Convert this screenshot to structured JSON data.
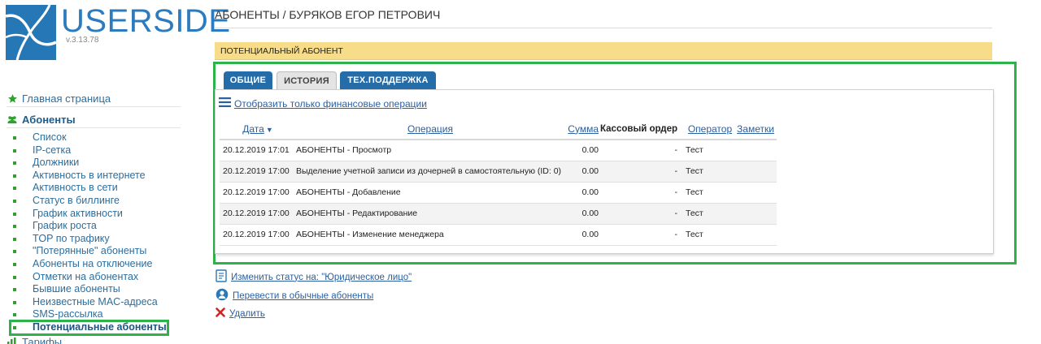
{
  "app": {
    "logo": "USERSIDE",
    "version": "v.3.13.78"
  },
  "sidebar": {
    "main_link": "Главная страница",
    "section": "Абоненты",
    "items": [
      "Список",
      "IP-сетка",
      "Должники",
      "Активность в интернете",
      "Активность в сети",
      "Статус в биллинге",
      "График активности",
      "График роста",
      "TOP по трафику",
      "\"Потерянные\" абоненты",
      "Абоненты на отключение",
      "Отметки на абонентах",
      "Бывшие абоненты",
      "Неизвестные MAC-адреса",
      "SMS-рассылка",
      "Потенциальные абоненты"
    ],
    "next_section": "Тарифы"
  },
  "header": {
    "breadcrumb": "АБОНЕНТЫ / БУРЯКОВ ЕГОР ПЕТРОВИЧ",
    "status": "ПОТЕНЦИАЛЬНЫЙ АБОНЕНТ"
  },
  "tabs": [
    "ОБЩИЕ",
    "ИСТОРИЯ",
    "ТЕХ.ПОДДЕРЖКА"
  ],
  "filter_link": "Отобразить только финансовые операции",
  "table": {
    "headers": {
      "date": "Дата",
      "operation": "Операция",
      "sum": "Сумма",
      "cash_order": "Кассовый ордер",
      "operator": "Оператор",
      "notes": "Заметки"
    },
    "rows": [
      {
        "date": "20.12.2019 17:01",
        "operation": "АБОНЕНТЫ - Просмотр",
        "sum": "0.00",
        "cash_order": "-",
        "operator": "Тест",
        "notes": ""
      },
      {
        "date": "20.12.2019 17:00",
        "operation": "Выделение учетной записи из дочерней в самостоятельную (ID: 0)",
        "sum": "0.00",
        "cash_order": "-",
        "operator": "Тест",
        "notes": ""
      },
      {
        "date": "20.12.2019 17:00",
        "operation": "АБОНЕНТЫ - Добавление",
        "sum": "0.00",
        "cash_order": "-",
        "operator": "Тест",
        "notes": ""
      },
      {
        "date": "20.12.2019 17:00",
        "operation": "АБОНЕНТЫ - Редактирование",
        "sum": "0.00",
        "cash_order": "-",
        "operator": "Тест",
        "notes": ""
      },
      {
        "date": "20.12.2019 17:00",
        "operation": "АБОНЕНТЫ - Изменение менеджера",
        "sum": "0.00",
        "cash_order": "-",
        "operator": "Тест",
        "notes": ""
      }
    ]
  },
  "actions": {
    "change_status": "Изменить статус на: \"Юридическое лицо\"",
    "convert": "Перевести в обычные абоненты",
    "delete": "Удалить"
  },
  "colors": {
    "accent": "#256da8",
    "status_bar": "#f7dc8a",
    "highlight_frame": "#2db34a",
    "delete_icon": "#d22525"
  }
}
